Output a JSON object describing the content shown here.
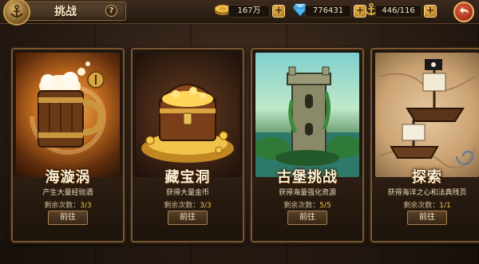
{
  "header": {
    "title": "挑战",
    "help_label": "?",
    "icons": {
      "emblem": "anchor-emblem-icon",
      "back": "back-arrow-icon"
    }
  },
  "resources": [
    {
      "icon": "gold-coin-icon",
      "value": "167万",
      "plus": "+"
    },
    {
      "icon": "diamond-icon",
      "value": "776431",
      "plus": "+"
    },
    {
      "icon": "anchor-icon",
      "value": "446/116",
      "plus": "+"
    }
  ],
  "cards": [
    {
      "title": "海漩涡",
      "desc": "产生大量经验酒",
      "remaining_label": "剩余次数：",
      "remaining": "3/3",
      "button": "前往",
      "art": "beer-mug"
    },
    {
      "title": "藏宝洞",
      "desc": "获得大量金币",
      "remaining_label": "剩余次数：",
      "remaining": "3/3",
      "button": "前往",
      "art": "treasure-chest"
    },
    {
      "title": "古堡挑战",
      "desc": "获得海量强化资源",
      "remaining_label": "剩余次数：",
      "remaining": "5/5",
      "button": "前往",
      "art": "ancient-castle"
    },
    {
      "title": "探索",
      "desc": "获得海洋之心和法典残页",
      "remaining_label": "剩余次数：",
      "remaining": "1/1",
      "button": "前往",
      "art": "pirate-ship"
    }
  ],
  "colors": {
    "accent_gold": "#f2c451",
    "frame": "#7a5730",
    "back_button": "#c8381f"
  }
}
